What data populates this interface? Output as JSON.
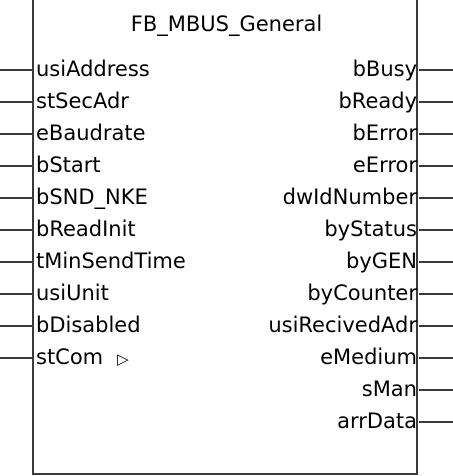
{
  "block": {
    "title": "FB_MBUS_General",
    "inputs": [
      "usiAddress",
      "stSecAdr",
      "eBaudrate",
      "bStart",
      "bSND_NKE",
      "bReadInit",
      "tMinSendTime",
      "usiUnit",
      "bDisabled",
      "stCom"
    ],
    "input_marker": "▷",
    "outputs": [
      "bBusy",
      "bReady",
      "bError",
      "eError",
      "dwIdNumber",
      "byStatus",
      "byGEN",
      "byCounter",
      "usiRecivedAdr",
      "eMedium",
      "sMan",
      "arrData"
    ]
  }
}
